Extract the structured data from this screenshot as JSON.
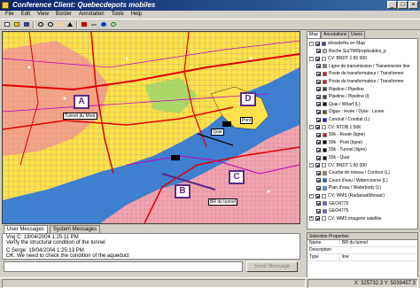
{
  "window": {
    "title": "Conference Client: Quebecdepots mobiles"
  },
  "menu": [
    "File",
    "Edit",
    "View",
    "Border",
    "Annotation",
    "Tools",
    "Help"
  ],
  "toolbar": {
    "icons": [
      "new-icon",
      "open-icon",
      "save-icon",
      "zoom-in-icon",
      "zoom-out-icon",
      "pan-icon",
      "select-icon",
      "annotate-icon",
      "measure-icon",
      "info-icon",
      "refresh-icon"
    ]
  },
  "map": {
    "markers": [
      "A",
      "B",
      "C",
      "D"
    ],
    "labels": [
      "Tunnel du Mont",
      "BR du tunnel",
      "Pont",
      "Quai"
    ]
  },
  "bottom_tabs": [
    "User Messages",
    "System Messages"
  ],
  "messages": [
    "Vrej C: 19/04/2004 1:25:11 PM",
    "Verify the structural condition of the tunnel",
    "",
    "C.Serge: 19/04/2004 1:25:13 PM",
    "OK. We need to check the condition of the aqueduct"
  ],
  "send": {
    "label": "Send Message"
  },
  "status": {
    "coords": "X: 325732.3 Y: 5039457.3"
  },
  "right_tabs": [
    "Map",
    "Annotations",
    "Users"
  ],
  "tree": [
    {
      "indent": 0,
      "label": "showdefns en Map",
      "exp": "-",
      "check": true,
      "color": "#5b2a86"
    },
    {
      "indent": 1,
      "label": "Roche.Su(TM9)replicables_p",
      "exp": "",
      "check": true,
      "color": "#c0c0c0"
    },
    {
      "indent": 0,
      "label": "CV: BNDT 1:50 000",
      "exp": "-",
      "check": true,
      "color": "#ffffff"
    },
    {
      "indent": 1,
      "label": "Ligne de transmission / Transmission line",
      "exp": "",
      "check": true,
      "color": "#808080"
    },
    {
      "indent": 1,
      "label": "Poste de transformateur / Transformer",
      "exp": "",
      "check": true,
      "color": "#ff0000"
    },
    {
      "indent": 1,
      "label": "Poste de transformateur / Transformer",
      "exp": "",
      "check": true,
      "color": "#ff0000"
    },
    {
      "indent": 1,
      "label": "Pipeline / Pipeline",
      "exp": "",
      "check": true,
      "color": "#404040"
    },
    {
      "indent": 1,
      "label": "Pipeline / Pipeline (l)",
      "exp": "",
      "check": true,
      "color": "#404040"
    },
    {
      "indent": 1,
      "label": "Quai / Wharf (L)",
      "exp": "",
      "check": true,
      "color": "#000000"
    },
    {
      "indent": 1,
      "label": "Digue : levée / Dyke : Levee",
      "exp": "",
      "check": true,
      "color": "#804000"
    },
    {
      "indent": 1,
      "label": "Conduit / Conduit (L)",
      "exp": "",
      "check": true,
      "color": "#0000ff"
    },
    {
      "indent": 0,
      "label": "CV: NTDB 1:50K",
      "exp": "-",
      "check": true,
      "color": "#ffffff"
    },
    {
      "indent": 1,
      "label": "50k - Route (ligne)",
      "exp": "",
      "check": true,
      "color": "#ff0000"
    },
    {
      "indent": 1,
      "label": "50k - Pont (ligne)",
      "exp": "",
      "check": true,
      "color": "#000000"
    },
    {
      "indent": 1,
      "label": "50k - Tunnel (ligne)",
      "exp": "",
      "check": true,
      "color": "#000000"
    },
    {
      "indent": 1,
      "label": "50k - Quai",
      "exp": "",
      "check": true,
      "color": "#000000"
    },
    {
      "indent": 0,
      "label": "CV: BNDT 1:50 000",
      "exp": "-",
      "check": true,
      "color": "#ffffff"
    },
    {
      "indent": 1,
      "label": "Courbe de niveau / Contour (L)",
      "exp": "",
      "check": true,
      "color": "#c08040"
    },
    {
      "indent": 1,
      "label": "Cours d'eau / Watercourse (L)",
      "exp": "",
      "check": true,
      "color": "#0060ff"
    },
    {
      "indent": 1,
      "label": "Plan d'eau / Waterbody (L)",
      "exp": "",
      "check": true,
      "color": "#40a0ff"
    },
    {
      "indent": 0,
      "label": "CV: WMS (Radarsat/Mosaic)",
      "exp": "-",
      "check": true,
      "color": "#ffffff"
    },
    {
      "indent": 1,
      "label": "GEO4775",
      "exp": "",
      "check": true,
      "color": "#6060ff"
    },
    {
      "indent": 1,
      "label": "GEO4775",
      "exp": "",
      "check": true,
      "color": "#6060ff"
    },
    {
      "indent": 0,
      "label": "CV: WMS imagerie satellite",
      "exp": "+",
      "check": true,
      "color": "#ffffff"
    }
  ],
  "properties": {
    "title": "Selection Properties",
    "rows": [
      {
        "k": "Name",
        "v": "BR du tunnel"
      },
      {
        "k": "Description",
        "v": ""
      },
      {
        "k": "Type",
        "v": "line"
      }
    ]
  }
}
